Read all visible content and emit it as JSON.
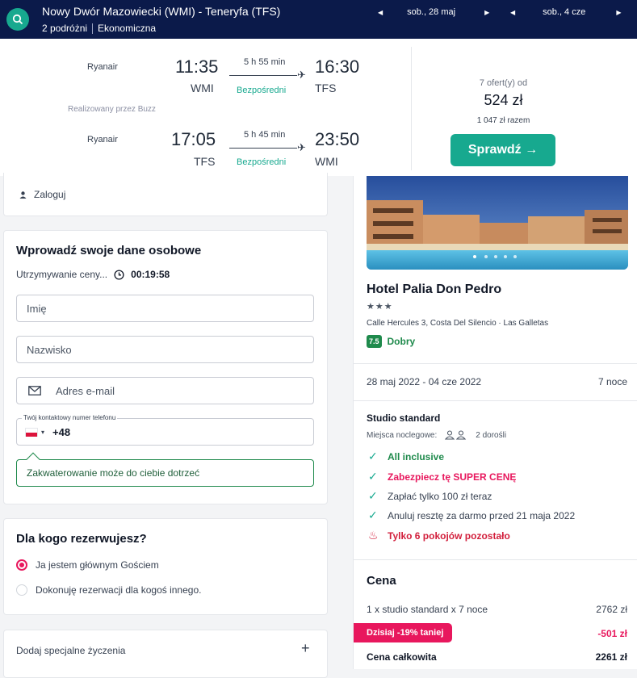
{
  "header": {
    "route": "Nowy Dwór Mazowiecki (WMI) - Teneryfa (TFS)",
    "travellers": "2 podróżni",
    "cabin": "Ekonomiczna",
    "date_out": "sob., 28 maj",
    "date_back": "sob., 4 cze"
  },
  "flights": {
    "outbound": {
      "airline": "Ryanair",
      "dep_time": "11:35",
      "arr_time": "16:30",
      "dep_code": "WMI",
      "arr_code": "TFS",
      "duration": "5 h 55 min",
      "type": "Bezpośredni"
    },
    "operated_by": "Realizowany przez Buzz",
    "inbound": {
      "airline": "Ryanair",
      "dep_time": "17:05",
      "arr_time": "23:50",
      "dep_code": "TFS",
      "arr_code": "WMI",
      "duration": "5 h 45 min",
      "type": "Bezpośredni"
    },
    "offers": "7 ofert(y) od",
    "price": "524 zł",
    "total": "1 047 zł razem",
    "cta": "Sprawdź →"
  },
  "login": {
    "label": "Zaloguj"
  },
  "personal": {
    "title": "Wprowadź swoje dane osobowe",
    "hold_label": "Utrzymywanie ceny...",
    "hold_timer": "00:19:58",
    "first_name_placeholder": "Imię",
    "last_name_placeholder": "Nazwisko",
    "email_placeholder": "Adres e-mail",
    "phone_label": "Twój kontaktowy numer telefonu",
    "phone_prefix": "+48",
    "info_note": "Zakwaterowanie może do ciebie dotrzeć"
  },
  "booking_for": {
    "title": "Dla kogo rezerwujesz?",
    "option_self": "Ja jestem głównym Gościem",
    "option_other": "Dokonuję rezerwacji dla kogoś innego."
  },
  "special": {
    "label": "Dodaj specjalne życzenia",
    "plus": "+"
  },
  "hotel": {
    "name": "Hotel Palia Don Pedro",
    "stars": "★★★",
    "address": "Calle Hercules 3, Costa Del Silencio · Las Galletas",
    "rating": "7.5",
    "rating_label": "Dobry",
    "dates": "28 maj 2022 - 04 cze 2022",
    "nights": "7 noce",
    "room": "Studio standard",
    "beds_label": "Miejsca noclegowe:",
    "guests": "2 dorośli",
    "perks": [
      "All inclusive",
      "Zabezpiecz tę SUPER CENĘ",
      "Zapłać tylko 100 zł teraz",
      "Anuluj resztę za darmo przed 21 maja 2022"
    ],
    "rooms_left": "Tylko 6 pokojów pozostało"
  },
  "price": {
    "title": "Cena",
    "line_label": "1 x studio standard x 7 noce",
    "line_value": "2762 zł",
    "discount_label": "Dzisiaj -19% taniej",
    "discount_value": "-501 zł",
    "total_label": "Cena całkowita",
    "total_value": "2261 zł"
  },
  "colors": {
    "navy": "#0b1a4a",
    "teal": "#17a98f",
    "pink": "#e8175d",
    "rating": "#1f8a4c"
  }
}
